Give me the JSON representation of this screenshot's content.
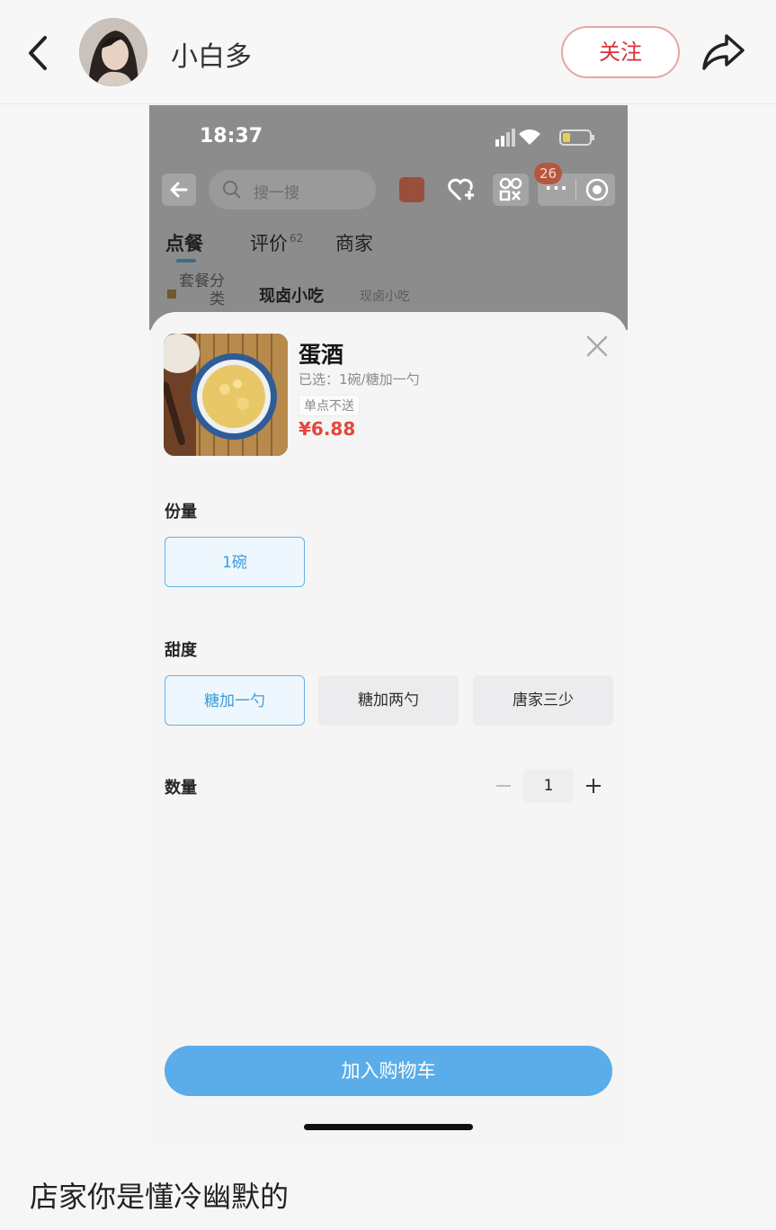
{
  "header": {
    "username": "小白多",
    "follow_label": "关注",
    "icons": {
      "back": "chevron-left-icon",
      "share": "share-arrow-icon"
    }
  },
  "screenshot": {
    "status_bar": {
      "time": "18:37"
    },
    "nav": {
      "search_placeholder": "搜一搜",
      "badge_count": "26",
      "icons": [
        "back-arrow-icon",
        "search-icon",
        "red-packet-icon",
        "heart-add-icon",
        "qr-scan-icon",
        "more-dots-icon",
        "target-icon"
      ]
    },
    "tabs": [
      {
        "label": "点餐",
        "sup": ""
      },
      {
        "label": "评价",
        "sup": "62"
      },
      {
        "label": "商家",
        "sup": ""
      }
    ],
    "category": {
      "side_label": "套餐分类",
      "title": "现卤小吃",
      "subtitle": "现卤小吃"
    },
    "sheet": {
      "dish_name": "蛋酒",
      "selected": "已选：1碗/糖加一勺",
      "tag": "单点不送",
      "price": "¥6.88",
      "portion_label": "份量",
      "portion_options": [
        "1碗"
      ],
      "sweetness_label": "甜度",
      "sweetness_options": [
        "糖加一勺",
        "糖加两勺",
        "唐家三少"
      ],
      "quantity_label": "数量",
      "quantity": "1",
      "add_to_cart": "加入购物车"
    }
  },
  "caption": "店家你是懂冷幽默的",
  "colors": {
    "follow": "#d6333b",
    "accent_blue": "#5aade9",
    "price_red": "#e2483b"
  }
}
